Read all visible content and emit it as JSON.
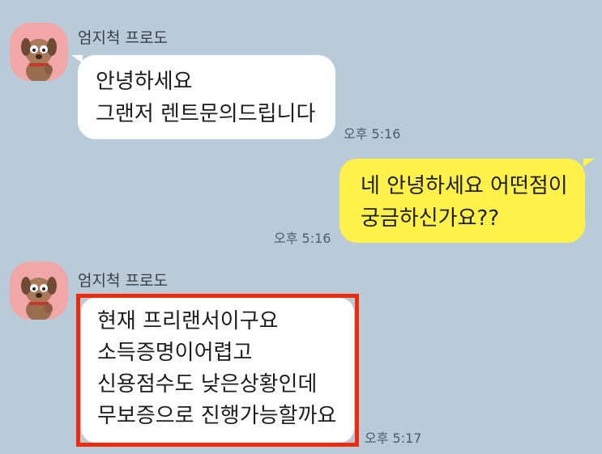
{
  "messages": [
    {
      "sender": "엄지척 프로도",
      "lines": [
        "안녕하세요",
        "그랜저 렌트문의드립니다"
      ],
      "time": "오후 5:16"
    },
    {
      "lines": [
        "네 안녕하세요 어떤점이",
        "궁금하신가요??"
      ],
      "time": "오후 5:16"
    },
    {
      "sender": "엄지척 프로도",
      "lines": [
        "현재 프리랜서이구요",
        "소득증명이어렵고",
        "신용점수도 낮은상황인데",
        "무보증으로 진행가능할까요"
      ],
      "time": "오후 5:17"
    }
  ],
  "colors": {
    "background": "#b9cbd9",
    "incoming_bubble": "#ffffff",
    "outgoing_bubble": "#fef14a",
    "highlight": "#f02a0c",
    "avatar_bg": "#f1a7a8"
  },
  "icons": {
    "avatar": "frodo-dog-avatar-icon"
  }
}
